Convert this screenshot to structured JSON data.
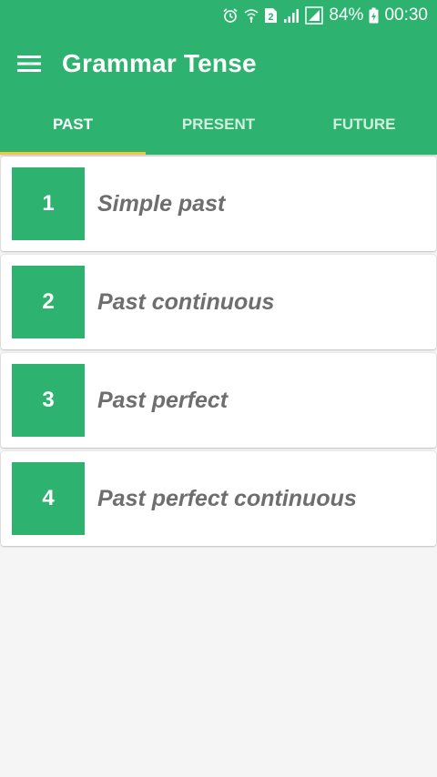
{
  "colors": {
    "primary": "#2db36f",
    "tab_indicator": "#f4c542",
    "label_text": "#6e6e6e"
  },
  "status_bar": {
    "icons": [
      "alarm-icon",
      "wifi-icon",
      "sim-2-icon",
      "signal-icon",
      "signal-box-icon",
      "battery-charging-icon"
    ],
    "sim_badge": "2",
    "battery": "84%",
    "time": "00:30"
  },
  "app_bar": {
    "menu_icon": "hamburger-menu-icon",
    "title": "Grammar Tense"
  },
  "tabs": [
    {
      "label": "PAST",
      "active": true
    },
    {
      "label": "PRESENT",
      "active": false
    },
    {
      "label": "FUTURE",
      "active": false
    }
  ],
  "items": [
    {
      "number": "1",
      "label": "Simple past"
    },
    {
      "number": "2",
      "label": "Past continuous"
    },
    {
      "number": "3",
      "label": "Past perfect"
    },
    {
      "number": "4",
      "label": "Past perfect continuous"
    }
  ]
}
